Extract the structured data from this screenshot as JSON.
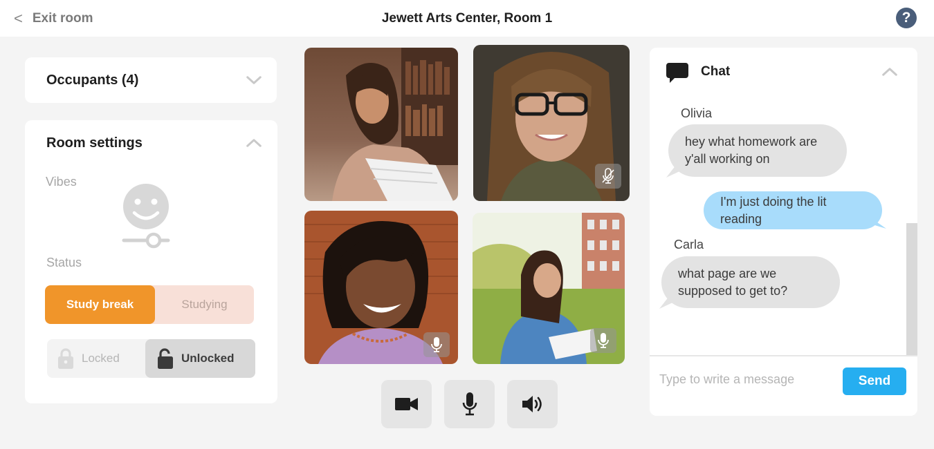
{
  "header": {
    "exit_label": "Exit room",
    "room_title": "Jewett Arts Center, Room 1",
    "help_glyph": "?"
  },
  "occupants": {
    "title": "Occupants (4)",
    "collapsed": true
  },
  "room_settings": {
    "title": "Room settings",
    "expanded": true,
    "vibes_label": "Vibes",
    "vibes_level": 0.5,
    "status_label": "Status",
    "status_options": [
      "Study break",
      "Studying"
    ],
    "status_selected": "Study break",
    "lock_options": [
      "Locked",
      "Unlocked"
    ],
    "lock_selected": "Unlocked"
  },
  "video_tiles": [
    {
      "participant_icon": "person-reading-papers",
      "mic": "none"
    },
    {
      "participant_icon": "person-with-glasses",
      "mic": "muted"
    },
    {
      "participant_icon": "person-smiling",
      "mic": "on"
    },
    {
      "participant_icon": "person-outdoors-reading",
      "mic": "on"
    }
  ],
  "controls": [
    {
      "name": "camera-button",
      "icon": "video-camera-icon"
    },
    {
      "name": "microphone-button",
      "icon": "microphone-icon"
    },
    {
      "name": "speaker-button",
      "icon": "speaker-icon"
    }
  ],
  "chat": {
    "title": "Chat",
    "messages": [
      {
        "sender": "Olivia",
        "direction": "in",
        "lines": [
          "hey what homework are",
          "y'all working on"
        ]
      },
      {
        "sender": "",
        "direction": "out",
        "lines": [
          "I'm just doing the lit reading"
        ]
      },
      {
        "sender": "Carla",
        "direction": "in",
        "lines": [
          "what page are we",
          "supposed to get to?"
        ]
      }
    ],
    "input_placeholder": "Type to write a message",
    "send_label": "Send"
  },
  "colors": {
    "accent_orange": "#f0952a",
    "send_blue": "#26aef0",
    "outgoing_bubble": "#a8dcfb",
    "incoming_bubble": "#e3e3e3",
    "help_navy": "#4a5e7a"
  }
}
